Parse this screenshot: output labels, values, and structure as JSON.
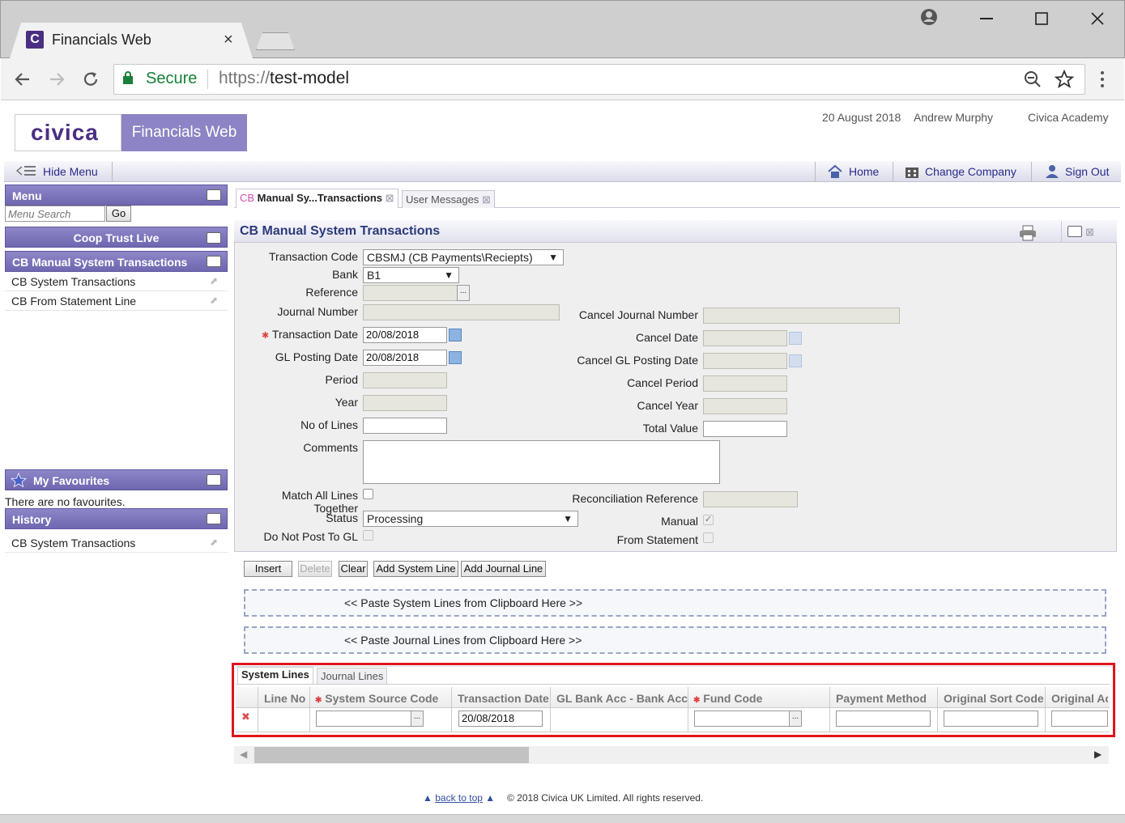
{
  "browser": {
    "tab_title": "Financials Web",
    "tab_logo": "C",
    "tab_close": "×",
    "secure_label": "Secure",
    "url_protocol": "https://",
    "url_host": "test-model",
    "icons": [
      "back-icon",
      "forward-icon",
      "reload-icon",
      "lock-icon",
      "zoom-icon",
      "star-icon",
      "more-icon",
      "account-icon",
      "minimize-icon",
      "maximize-icon",
      "close-icon"
    ]
  },
  "header": {
    "logo_text": "civica",
    "product": "Financials Web",
    "date": "20 August 2018",
    "user": "Andrew Murphy",
    "company": "Civica Academy"
  },
  "menubar": {
    "hide_menu": "Hide Menu",
    "home": "Home",
    "change_company": "Change Company",
    "sign_out": "Sign Out"
  },
  "left": {
    "menu_title": "Menu",
    "search_placeholder": "Menu Search",
    "go": "Go",
    "group_title": "Coop Trust Live",
    "section_title": "CB Manual System Transactions",
    "items": [
      "CB System Transactions",
      "CB From Statement Line"
    ],
    "favourites_title": "My Favourites",
    "no_favourites": "There are no favourites.",
    "history_title": "History",
    "history_items": [
      "CB System Transactions"
    ]
  },
  "tabs": {
    "active_prefix": "CB",
    "active_label": " Manual Sy...Transactions",
    "other_label": "User Messages",
    "close_glyph": "⊠"
  },
  "form": {
    "title": "CB Manual System Transactions",
    "transaction_code_label": "Transaction Code",
    "transaction_code_value": "CBSMJ (CB Payments\\Reciepts)",
    "bank_label": "Bank",
    "bank_value": "B1",
    "reference_label": "Reference",
    "journal_number_label": "Journal Number",
    "transaction_date_label": "Transaction Date",
    "transaction_date_value": "20/08/2018",
    "required_mark": "✱",
    "gl_posting_date_label": "GL Posting Date",
    "gl_posting_date_value": "20/08/2018",
    "period_label": "Period",
    "year_label": "Year",
    "no_of_lines_label": "No of Lines",
    "comments_label": "Comments",
    "match_all_label": "Match All Lines Together",
    "status_label": "Status",
    "status_value": "Processing",
    "do_not_post_label": "Do Not Post To GL",
    "cancel_journal_number_label": "Cancel Journal Number",
    "cancel_date_label": "Cancel Date",
    "cancel_gl_posting_date_label": "Cancel GL Posting Date",
    "cancel_period_label": "Cancel Period",
    "cancel_year_label": "Cancel Year",
    "total_value_label": "Total Value",
    "reconciliation_reference_label": "Reconciliation Reference",
    "manual_label": "Manual",
    "manual_checked": true,
    "from_statement_label": "From Statement",
    "ellipsis": "..."
  },
  "actions": {
    "insert": "Insert",
    "delete": "Delete",
    "clear": "Clear",
    "add_system_line": "Add System Line",
    "add_journal_line": "Add Journal Line"
  },
  "paste": {
    "system": "<< Paste System Lines from Clipboard Here >>",
    "journal": "<< Paste Journal Lines from Clipboard Here >>"
  },
  "lines": {
    "tab_system": "System Lines",
    "tab_journal": "Journal Lines",
    "columns": [
      "Line No",
      "System Source Code",
      "Transaction Date",
      "GL Bank Acc - Bank Acc",
      "Fund Code",
      "Payment Method",
      "Original Sort Code",
      "Original Ac"
    ],
    "row_transaction_date": "20/08/2018",
    "delete_glyph": "✖"
  },
  "footer": {
    "back_to_top": "back to top",
    "copyright": "© 2018 Civica UK Limited. All rights reserved."
  },
  "colors": {
    "brand_purple": "#4b2e83",
    "panel_header": "#7a73ba",
    "highlight_box": "#e0141e",
    "secure_green": "#188038"
  }
}
